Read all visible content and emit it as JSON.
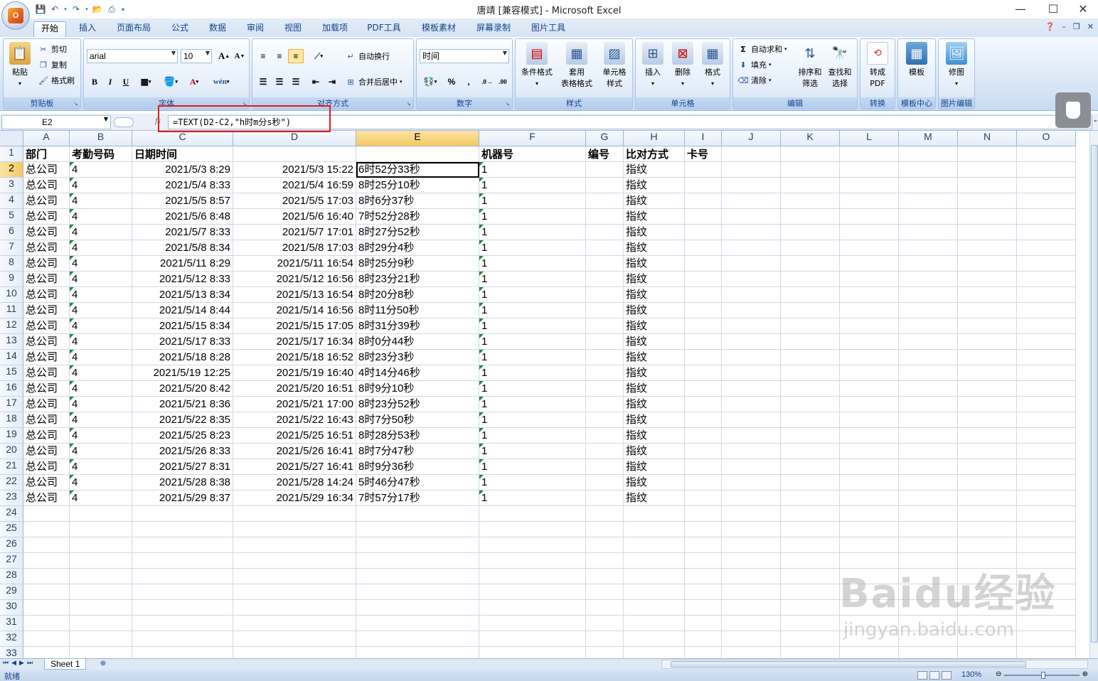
{
  "window": {
    "title": "唐靖  [兼容模式] - Microsoft Excel",
    "minimize": "—",
    "maximize": "☐",
    "close": "✕"
  },
  "quick_access": [
    "save-icon",
    "undo-icon",
    "redo-icon",
    "open-icon",
    "print-preview-icon"
  ],
  "tabs": [
    {
      "label": "开始",
      "active": true
    },
    {
      "label": "插入"
    },
    {
      "label": "页面布局"
    },
    {
      "label": "公式"
    },
    {
      "label": "数据"
    },
    {
      "label": "审阅"
    },
    {
      "label": "视图"
    },
    {
      "label": "加载项"
    },
    {
      "label": "PDF工具"
    },
    {
      "label": "模板素材"
    },
    {
      "label": "屏幕录制"
    },
    {
      "label": "图片工具"
    }
  ],
  "ribbon": {
    "clipboard": {
      "label": "剪贴板",
      "paste": "粘贴",
      "cut": "剪切",
      "copy": "复制",
      "format_painter": "格式刷"
    },
    "font": {
      "label": "字体",
      "name": "arial",
      "size": "10",
      "bold": "B",
      "italic": "I",
      "underline": "U"
    },
    "alignment": {
      "label": "对齐方式",
      "wrap": "自动换行",
      "merge": "合并后居中"
    },
    "number": {
      "label": "数字",
      "format": "时间",
      "percent": "%",
      "comma": ","
    },
    "styles": {
      "label": "样式",
      "conditional": "条件格式",
      "table": "套用\n表格格式",
      "cell_style": "单元格\n样式"
    },
    "cells": {
      "label": "单元格",
      "insert": "插入",
      "delete": "删除",
      "format": "格式"
    },
    "editing": {
      "label": "编辑",
      "autosum": "自动求和",
      "fill": "填充",
      "clear": "清除",
      "sort": "排序和\n筛选",
      "find": "查找和\n选择"
    },
    "convert": {
      "label": "转换",
      "to_pdf": "转成\nPDF"
    },
    "template_center": {
      "label": "模板中心",
      "template": "模板"
    },
    "image_edit": {
      "label": "图片编辑",
      "retouch": "修图"
    }
  },
  "formula_bar": {
    "cell_ref": "E2",
    "fx": "fx",
    "formula": "=TEXT(D2-C2,\"h时m分s秒\")"
  },
  "columns": [
    "A",
    "B",
    "C",
    "D",
    "E",
    "F",
    "G",
    "H",
    "I",
    "J",
    "K",
    "L",
    "M",
    "N",
    "O"
  ],
  "row_numbers": [
    "1",
    "2",
    "3",
    "4",
    "5",
    "6",
    "7",
    "8",
    "9",
    "10",
    "11",
    "12",
    "13",
    "14",
    "15",
    "16",
    "17",
    "18",
    "19",
    "20",
    "21",
    "22",
    "23",
    "24",
    "25",
    "26",
    "27",
    "28",
    "29",
    "30",
    "31",
    "32",
    "33"
  ],
  "header_row": {
    "A": "部门",
    "B": "考勤号码",
    "C": "日期时间",
    "D": "",
    "E": "",
    "F": "机器号",
    "G": "编号",
    "H": "比对方式",
    "I": "卡号"
  },
  "rows": [
    {
      "A": "总公司",
      "B": "4",
      "C": "2021/5/3 8:29",
      "D": "2021/5/3 15:22",
      "E": "6时52分33秒",
      "F": "1",
      "H": "指纹"
    },
    {
      "A": "总公司",
      "B": "4",
      "C": "2021/5/4 8:33",
      "D": "2021/5/4 16:59",
      "E": "8时25分10秒",
      "F": "1",
      "H": "指纹"
    },
    {
      "A": "总公司",
      "B": "4",
      "C": "2021/5/5 8:57",
      "D": "2021/5/5 17:03",
      "E": "8时6分37秒",
      "F": "1",
      "H": "指纹"
    },
    {
      "A": "总公司",
      "B": "4",
      "C": "2021/5/6 8:48",
      "D": "2021/5/6 16:40",
      "E": "7时52分28秒",
      "F": "1",
      "H": "指纹"
    },
    {
      "A": "总公司",
      "B": "4",
      "C": "2021/5/7 8:33",
      "D": "2021/5/7 17:01",
      "E": "8时27分52秒",
      "F": "1",
      "H": "指纹"
    },
    {
      "A": "总公司",
      "B": "4",
      "C": "2021/5/8 8:34",
      "D": "2021/5/8 17:03",
      "E": "8时29分4秒",
      "F": "1",
      "H": "指纹"
    },
    {
      "A": "总公司",
      "B": "4",
      "C": "2021/5/11 8:29",
      "D": "2021/5/11 16:54",
      "E": "8时25分9秒",
      "F": "1",
      "H": "指纹"
    },
    {
      "A": "总公司",
      "B": "4",
      "C": "2021/5/12 8:33",
      "D": "2021/5/12 16:56",
      "E": "8时23分21秒",
      "F": "1",
      "H": "指纹"
    },
    {
      "A": "总公司",
      "B": "4",
      "C": "2021/5/13 8:34",
      "D": "2021/5/13 16:54",
      "E": "8时20分8秒",
      "F": "1",
      "H": "指纹"
    },
    {
      "A": "总公司",
      "B": "4",
      "C": "2021/5/14 8:44",
      "D": "2021/5/14 16:56",
      "E": "8时11分50秒",
      "F": "1",
      "H": "指纹"
    },
    {
      "A": "总公司",
      "B": "4",
      "C": "2021/5/15 8:34",
      "D": "2021/5/15 17:05",
      "E": "8时31分39秒",
      "F": "1",
      "H": "指纹"
    },
    {
      "A": "总公司",
      "B": "4",
      "C": "2021/5/17 8:33",
      "D": "2021/5/17 16:34",
      "E": "8时0分44秒",
      "F": "1",
      "H": "指纹"
    },
    {
      "A": "总公司",
      "B": "4",
      "C": "2021/5/18 8:28",
      "D": "2021/5/18 16:52",
      "E": "8时23分3秒",
      "F": "1",
      "H": "指纹"
    },
    {
      "A": "总公司",
      "B": "4",
      "C": "2021/5/19 12:25",
      "D": "2021/5/19 16:40",
      "E": "4时14分46秒",
      "F": "1",
      "H": "指纹"
    },
    {
      "A": "总公司",
      "B": "4",
      "C": "2021/5/20 8:42",
      "D": "2021/5/20 16:51",
      "E": "8时9分10秒",
      "F": "1",
      "H": "指纹"
    },
    {
      "A": "总公司",
      "B": "4",
      "C": "2021/5/21 8:36",
      "D": "2021/5/21 17:00",
      "E": "8时23分52秒",
      "F": "1",
      "H": "指纹"
    },
    {
      "A": "总公司",
      "B": "4",
      "C": "2021/5/22 8:35",
      "D": "2021/5/22 16:43",
      "E": "8时7分50秒",
      "F": "1",
      "H": "指纹"
    },
    {
      "A": "总公司",
      "B": "4",
      "C": "2021/5/25 8:23",
      "D": "2021/5/25 16:51",
      "E": "8时28分53秒",
      "F": "1",
      "H": "指纹"
    },
    {
      "A": "总公司",
      "B": "4",
      "C": "2021/5/26 8:33",
      "D": "2021/5/26 16:41",
      "E": "8时7分47秒",
      "F": "1",
      "H": "指纹"
    },
    {
      "A": "总公司",
      "B": "4",
      "C": "2021/5/27 8:31",
      "D": "2021/5/27 16:41",
      "E": "8时9分36秒",
      "F": "1",
      "H": "指纹"
    },
    {
      "A": "总公司",
      "B": "4",
      "C": "2021/5/28 8:38",
      "D": "2021/5/28 14:24",
      "E": "5时46分47秒",
      "F": "1",
      "H": "指纹"
    },
    {
      "A": "总公司",
      "B": "4",
      "C": "2021/5/29 8:37",
      "D": "2021/5/29 16:34",
      "E": "7时57分17秒",
      "F": "1",
      "H": "指纹"
    }
  ],
  "active_cell": {
    "col": "E",
    "row": "2"
  },
  "sheet_tabs": [
    "Sheet 1"
  ],
  "status": {
    "ready": "就绪",
    "zoom": "130%",
    "zoom_level": 0.52
  },
  "watermark": {
    "logo": "Baidu经验",
    "url": "jingyan.baidu.com"
  },
  "colors": {
    "accent": "#15428b",
    "highlight": "#e21b1b",
    "selected_header": "#f4c862"
  }
}
